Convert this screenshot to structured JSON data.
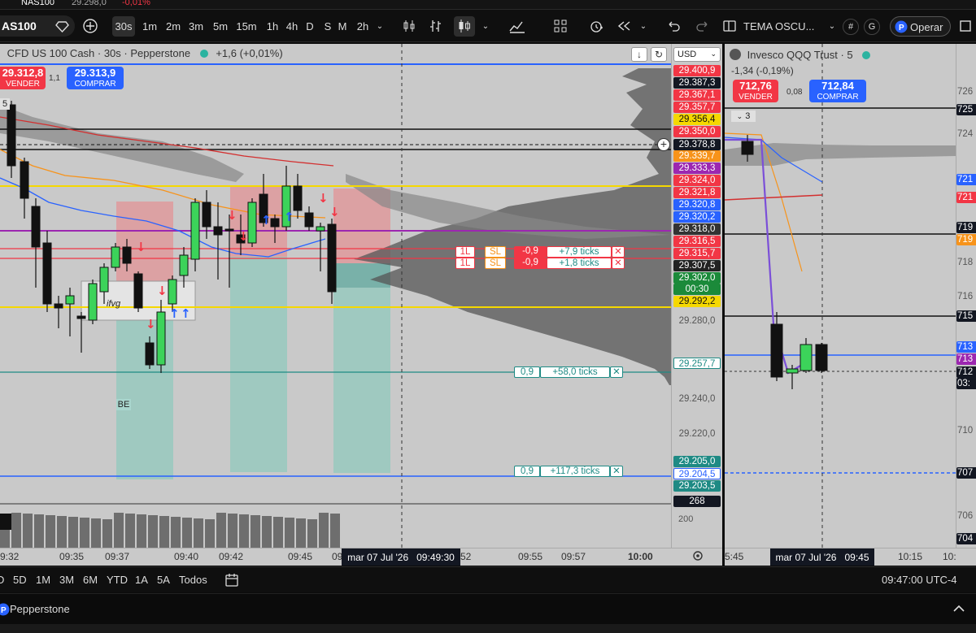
{
  "top_strip": {
    "symbol": "NAS100",
    "price": "29.298,0",
    "change": "-0,01%"
  },
  "toolbar": {
    "symbol": "AS100",
    "timeframes": [
      "30s",
      "1m",
      "2m",
      "3m",
      "5m",
      "15m",
      "1h",
      "4h",
      "D",
      "S",
      "M",
      "2h"
    ],
    "selected_timeframe": "30s",
    "theme_label": "TEMA OSCU...",
    "operate_label": "Operar",
    "hash_label": "#",
    "g_label": "G"
  },
  "main_chart": {
    "title": "CFD US 100 Cash · 30s · Pepperstone",
    "change": "+1,6 (+0,01%)",
    "sell_price": "29.312,8",
    "sell_label": "VENDER",
    "buy_price": "29.313,9",
    "buy_label": "COMPRAR",
    "spread": "1,1",
    "currency": "USD",
    "top_left_num": "5",
    "ifvg_label": "ifvg",
    "be_label": "BE",
    "volume_value": "268",
    "volume_axis_label": "200",
    "cursor_time": "mar 07 Jul '26   09:49:30",
    "time_labels": [
      "9:32",
      "09:35",
      "09:37",
      "09:40",
      "09:42",
      "09:45",
      "09",
      "52",
      "09:55",
      "09:57",
      "10:00"
    ],
    "price_labels": [
      {
        "v": "29.400,9",
        "bg": "#f23645"
      },
      {
        "v": "29.387,3",
        "bg": "#131722"
      },
      {
        "v": "29.367,1",
        "bg": "#f23645"
      },
      {
        "v": "29.357,7",
        "bg": "#f23645"
      },
      {
        "v": "29.356,4",
        "bg": "#f5d800",
        "fg": "#111"
      },
      {
        "v": "29.350,0",
        "bg": "#f23645"
      },
      {
        "v": "29.378,8",
        "bg": "#131722"
      },
      {
        "v": "29.339,7",
        "bg": "#f7931a"
      },
      {
        "v": "29.333,3",
        "bg": "#9c27b0"
      },
      {
        "v": "29.324,0",
        "bg": "#f23645"
      },
      {
        "v": "29.321,8",
        "bg": "#f23645"
      },
      {
        "v": "29.320,8",
        "bg": "#2962ff"
      },
      {
        "v": "29.320,2",
        "bg": "#2962ff"
      },
      {
        "v": "29.318,0",
        "bg": "#333333"
      },
      {
        "v": "29.316,5",
        "bg": "#f23645"
      },
      {
        "v": "29.315,7",
        "bg": "#f23645"
      },
      {
        "v": "29.307,5",
        "bg": "#222222"
      },
      {
        "v": "29.302,0",
        "bg": "#1b8a3a"
      },
      {
        "v": "00:30",
        "bg": "#1b8a3a"
      },
      {
        "v": "29.292,2",
        "bg": "#f5d800",
        "fg": "#111"
      },
      {
        "v": "29.280,0",
        "bg": "plain"
      },
      {
        "v": "29.257,7",
        "bg": "#ffffff",
        "fg": "#1e8a84"
      },
      {
        "v": "29.240,0",
        "bg": "plain"
      },
      {
        "v": "29.220,0",
        "bg": "plain"
      },
      {
        "v": "29.205,0",
        "bg": "#1e8a84"
      },
      {
        "v": "29.204,5",
        "bg": "#ffffff",
        "fg": "#2962ff"
      },
      {
        "v": "29.203,5",
        "bg": "#1e8a84"
      },
      {
        "v": "268",
        "bg": "#131722"
      }
    ],
    "orders": [
      {
        "qty": "1L",
        "type": "SL",
        "pnl": "-0,9",
        "ticks": "+7,9 ticks"
      },
      {
        "qty": "1L",
        "type": "SL",
        "pnl": "-0,9",
        "ticks": "+1,8 ticks"
      }
    ],
    "tp_orders": [
      {
        "qty": "0,9",
        "ticks": "+58,0 ticks"
      },
      {
        "qty": "0,9",
        "ticks": "+117,3 ticks"
      }
    ]
  },
  "side_chart": {
    "title": "Invesco QQQ Trust · 5",
    "change": "-1,34 (-0,19%)",
    "sell_price": "712,76",
    "sell_label": "VENDER",
    "buy_price": "712,84",
    "buy_label": "COMPRAR",
    "spread": "0,08",
    "top_left_num": "3",
    "price_labels": [
      {
        "v": "726",
        "bg": "plain"
      },
      {
        "v": "725",
        "bg": "#131722"
      },
      {
        "v": "724",
        "bg": "plain"
      },
      {
        "v": "721",
        "bg": "#2962ff"
      },
      {
        "v": "721",
        "bg": "#f23645"
      },
      {
        "v": "719",
        "bg": "#131722"
      },
      {
        "v": "719",
        "bg": "#f7931a"
      },
      {
        "v": "718",
        "bg": "plain"
      },
      {
        "v": "716",
        "bg": "plain"
      },
      {
        "v": "715",
        "bg": "#131722"
      },
      {
        "v": "713",
        "bg": "#2962ff"
      },
      {
        "v": "713",
        "bg": "#9c27b0"
      },
      {
        "v": "712",
        "bg": "#131722"
      },
      {
        "v": "03:",
        "bg": "#131722"
      },
      {
        "v": "710",
        "bg": "plain"
      },
      {
        "v": "707",
        "bg": "#131722"
      },
      {
        "v": "706",
        "bg": "plain"
      },
      {
        "v": "704",
        "bg": "#131722"
      }
    ],
    "cursor_time": "mar 07 Jul '26   09:45",
    "time_labels": [
      "5:45",
      "10:15",
      "10:"
    ]
  },
  "range_bar": {
    "ranges": [
      "D",
      "5D",
      "1M",
      "3M",
      "6M",
      "YTD",
      "1A",
      "5A",
      "Todos"
    ],
    "clock": "09:47:00 UTC-4"
  },
  "broker_bar": {
    "name": "Pepperstone"
  }
}
